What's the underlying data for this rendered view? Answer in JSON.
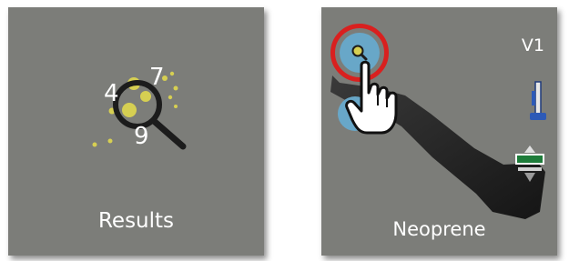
{
  "tiles": [
    {
      "label": "Results",
      "icon": "results-magnifier-icon",
      "icon_digits": [
        "4",
        "7",
        "9"
      ]
    },
    {
      "label": "Neoprene",
      "version": "V1",
      "icons": [
        "zoom-icon",
        "pointer-hand-icon",
        "dumbbell-specimen-icon",
        "grip-icon",
        "fixture-icon"
      ],
      "zoom_highlight_color": "#d9201f"
    }
  ],
  "colors": {
    "tile_bg": "#7c7d79",
    "dots": "#d6cf52",
    "fixture_green": "#1e7c3a"
  }
}
